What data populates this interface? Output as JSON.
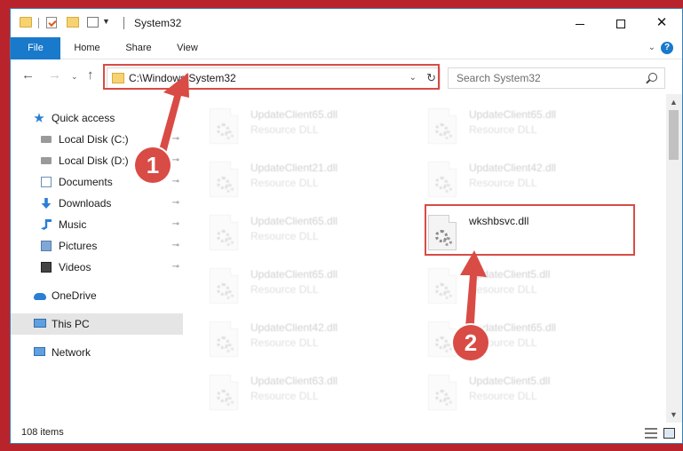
{
  "window": {
    "title": "System32",
    "minimize_glyph": "",
    "close_glyph": "✕"
  },
  "ribbon": {
    "tabs": [
      "File",
      "Home",
      "Share",
      "View"
    ],
    "expand_glyph": "⌄",
    "help_glyph": "?"
  },
  "nav": {
    "back_glyph": "←",
    "forward_glyph": "→",
    "recent_glyph": "⌄",
    "up_glyph": "↑",
    "address_path": "C:\\Windows\\System32",
    "address_drop_glyph": "⌄",
    "refresh_glyph": "↻",
    "search_placeholder": "Search System32"
  },
  "sidebar": {
    "items": [
      {
        "label": "Quick access",
        "icon": "star-icon",
        "pinned": false
      },
      {
        "label": "Local Disk (C:)",
        "icon": "drive-icon",
        "pinned": true
      },
      {
        "label": "Local Disk (D:)",
        "icon": "drive-icon",
        "pinned": true
      },
      {
        "label": "Documents",
        "icon": "documents-icon",
        "pinned": true
      },
      {
        "label": "Downloads",
        "icon": "download-icon",
        "pinned": true
      },
      {
        "label": "Music",
        "icon": "music-icon",
        "pinned": true
      },
      {
        "label": "Pictures",
        "icon": "pictures-icon",
        "pinned": true
      },
      {
        "label": "Videos",
        "icon": "videos-icon",
        "pinned": true
      },
      {
        "label": "OneDrive",
        "icon": "cloud-icon",
        "pinned": false
      },
      {
        "label": "This PC",
        "icon": "computer-icon",
        "pinned": false,
        "selected": true
      },
      {
        "label": "Network",
        "icon": "network-icon",
        "pinned": false
      }
    ],
    "pin_glyph": "📌"
  },
  "files": [
    {
      "name": "UpdateClient65.dll",
      "type": "Resource DLL"
    },
    {
      "name": "UpdateClient65.dll",
      "type": "Resource DLL"
    },
    {
      "name": "UpdateClient21.dll",
      "type": "Resource DLL"
    },
    {
      "name": "UpdateClient42.dll",
      "type": "Resource DLL"
    },
    {
      "name": "UpdateClient65.dll",
      "type": "Resource DLL"
    },
    {
      "name": "wkshbsvc.dll",
      "type": ""
    },
    {
      "name": "UpdateClient65.dll",
      "type": "Resource DLL"
    },
    {
      "name": "UpdateClient5.dll",
      "type": "Resource DLL"
    },
    {
      "name": "UpdateClient42.dll",
      "type": "Resource DLL"
    },
    {
      "name": "UpdateClient65.dll",
      "type": "Resource DLL"
    },
    {
      "name": "UpdateClient63.dll",
      "type": "Resource DLL"
    },
    {
      "name": "UpdateClient5.dll",
      "type": "Resource DLL"
    }
  ],
  "status": {
    "item_count": "108 items"
  },
  "annotations": {
    "step1": "1",
    "step2": "2"
  },
  "colors": {
    "accent": "#1979ca",
    "highlight": "#d94b45",
    "background": "#b9232b"
  }
}
